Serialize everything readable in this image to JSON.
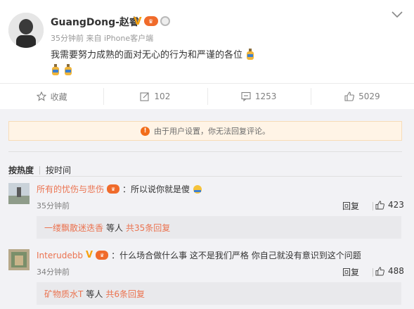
{
  "post": {
    "username": "GuangDong-赵睿",
    "meta": "35分钟前 来自 iPhone客户端",
    "text": "我需要努力成熟的面对无心的行为和严谨的各位",
    "badge_v": "V"
  },
  "actions": {
    "favorite_label": "收藏",
    "repost_count": "102",
    "comment_count": "1253",
    "like_count": "5029"
  },
  "notice": {
    "text": "由于用户设置，你无法回复评论。"
  },
  "sort": {
    "hot": "按热度",
    "time": "按时间"
  },
  "comments": [
    {
      "name": "所有的忧伤与悲伤",
      "text": "：所以说你就是傻",
      "time": "35分钟前",
      "reply_label": "回复",
      "likes": "423",
      "sub_user": "一缕飘散迷迭香",
      "sub_mid": "等人",
      "sub_count": "共35条回复"
    },
    {
      "name": "Interudebb",
      "badge_v": "V",
      "text": "：什么场合做什么事 这不是我们严格 你自己就没有意识到这个问题",
      "time": "34分钟前",
      "reply_label": "回复",
      "likes": "488",
      "sub_user": "矿物质水T",
      "sub_mid": "等人",
      "sub_count": "共6条回复"
    }
  ],
  "colors": {
    "accent": "#eb7350",
    "vip": "#f06b2b",
    "verified": "#f7a10d",
    "notice_bg": "#fff4e6"
  }
}
